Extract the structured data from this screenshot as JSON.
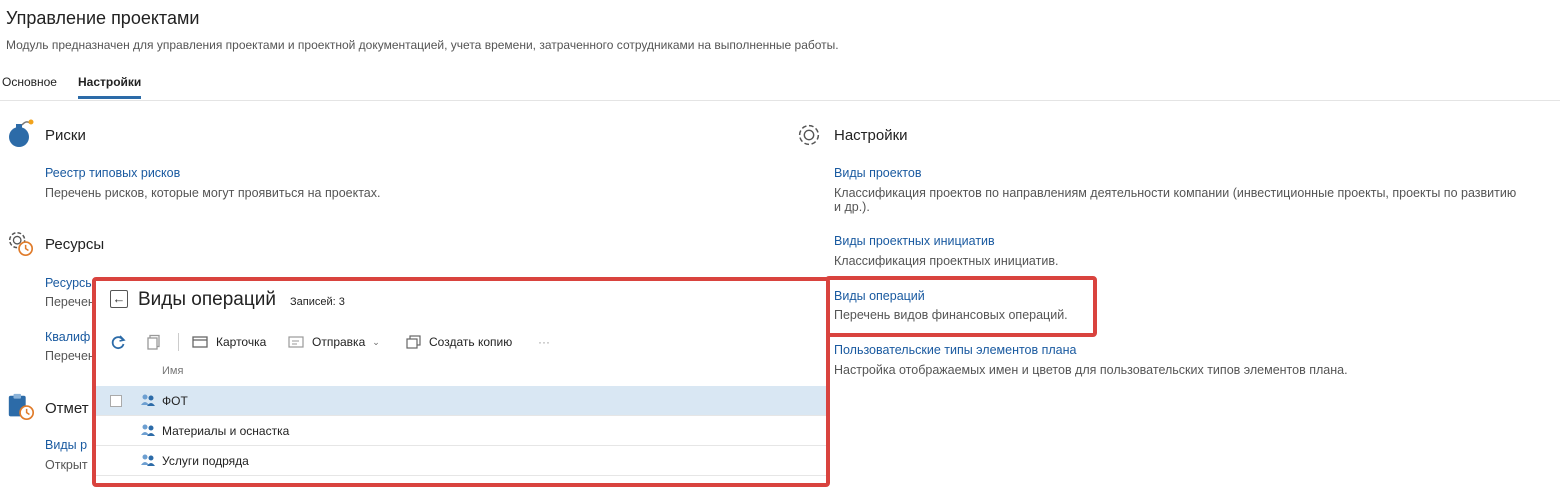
{
  "page": {
    "title": "Управление проектами",
    "description": "Модуль предназначен для управления проектами и проектной документацией, учета времени, затраченного сотрудниками на выполненные работы."
  },
  "tabs": [
    {
      "label": "Основное",
      "active": false
    },
    {
      "label": "Настройки",
      "active": true
    }
  ],
  "left_sections": {
    "risks": {
      "title": "Риски",
      "icon": "bomb-icon",
      "items": [
        {
          "link": "Реестр типовых рисков",
          "desc": "Перечень рисков, которые могут проявиться на проектах."
        }
      ]
    },
    "resources": {
      "title": "Ресурсы",
      "icon": "gear-clock-icon",
      "items": [
        {
          "link": "Ресурсы",
          "desc": "Перечень"
        },
        {
          "link": "Квалиф",
          "desc": "Перечень"
        }
      ]
    },
    "marks": {
      "title": "Отмет",
      "icon": "clipboard-clock-icon",
      "items": [
        {
          "link": "Виды р",
          "desc": "Открыт"
        }
      ]
    }
  },
  "right_section": {
    "title": "Настройки",
    "icon": "gear-icon",
    "items": [
      {
        "link": "Виды проектов",
        "desc_line1": "Классификация проектов по направлениям деятельности компании (инвестиционные проекты, проекты по развитию",
        "desc_line2": "и др.)."
      },
      {
        "link": "Виды проектных инициатив",
        "desc": "Классификация проектных инициатив."
      },
      {
        "link": "Виды операций",
        "desc": "Перечень видов финансовых операций."
      },
      {
        "link": "Пользовательские типы элементов плана",
        "desc": "Настройка отображаемых имен и цветов для пользовательских типов элементов плана."
      }
    ]
  },
  "popup": {
    "title": "Виды операций",
    "count_label": "Записей: 3",
    "toolbar": {
      "card": "Карточка",
      "send": "Отправка",
      "copy": "Создать копию",
      "more": "···"
    },
    "column_header": "Имя",
    "rows": [
      {
        "name": "ФОТ",
        "selected": true
      },
      {
        "name": "Материалы и оснастка",
        "selected": false
      },
      {
        "name": "Услуги подряда",
        "selected": false
      }
    ]
  },
  "colors": {
    "accent": "#2c6ba8",
    "link": "#1a5aa0",
    "highlight": "#d9433e",
    "selected_row": "#d9e7f3"
  }
}
